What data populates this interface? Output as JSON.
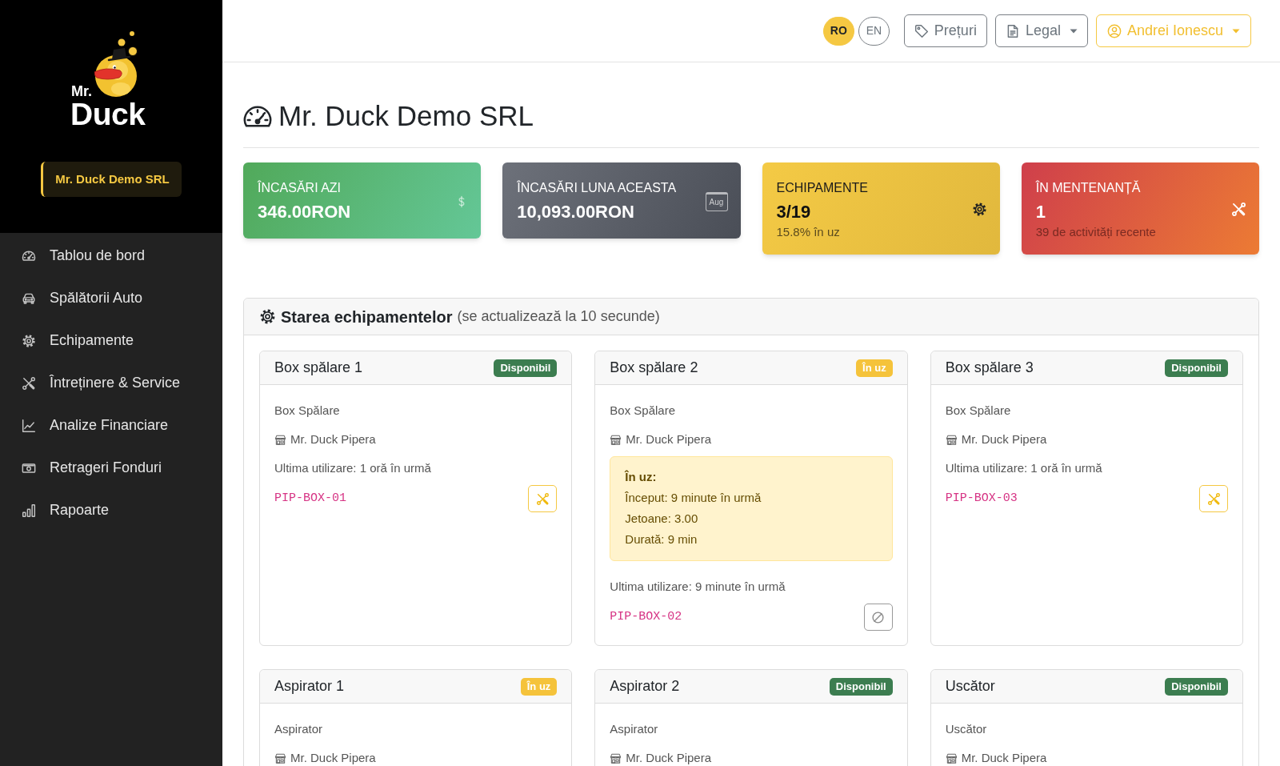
{
  "sidebar": {
    "logo": {
      "small_text": "Mr.",
      "large_text": "Duck"
    },
    "company": "Mr. Duck Demo SRL",
    "items": [
      {
        "label": "Tablou de bord",
        "selected": false
      },
      {
        "label": "Spălătorii Auto",
        "selected": false
      },
      {
        "label": "Echipamente",
        "selected": false
      },
      {
        "label": "Întreținere & Service",
        "selected": false
      },
      {
        "label": "Analize Financiare",
        "selected": false
      },
      {
        "label": "Retrageri Fonduri",
        "selected": false
      },
      {
        "label": "Rapoarte",
        "selected": false
      }
    ]
  },
  "top_bar": {
    "languages": [
      {
        "label": "RO",
        "selected": true
      },
      {
        "label": "EN",
        "selected": false
      }
    ],
    "buttons": [
      {
        "kind": "plain",
        "label": "Prețuri"
      },
      {
        "kind": "dropdown",
        "label": "Legal"
      },
      {
        "kind": "user",
        "label": "Andrei Ionescu"
      }
    ]
  },
  "page": {
    "title": "Mr. Duck Demo SRL"
  },
  "stats": [
    {
      "kind": "success",
      "label": "ÎNCASĂRI AZI",
      "value": "346.00RON"
    },
    {
      "kind": "neutral",
      "label": "ÎNCASĂRI LUNA ACEASTA",
      "value": "10,093.00RON",
      "icon_text": "Aug"
    },
    {
      "kind": "warning",
      "label": "ECHIPAMENTE",
      "value": "3/19",
      "note": "15.8% în uz"
    },
    {
      "kind": "danger",
      "label": "ÎN MENTENANȚĂ",
      "value": "1",
      "note": "39 de activități recente"
    }
  ],
  "equipment_status": {
    "title": "Starea echipamentelor",
    "note": "(se actualizează la 10 secunde)",
    "cards": [
      {
        "name": "Box spălare 1",
        "status": {
          "label": "Disponibil",
          "kind": "available"
        },
        "type": "Box Spălare",
        "location": "Mr. Duck Pipera",
        "last_used": "Ultima utilizare: 1 oră în urmă",
        "code": "PIP-BOX-01",
        "action": {
          "kind": "maintenance"
        }
      },
      {
        "name": "Box spălare 2",
        "status": {
          "label": "În uz",
          "kind": "in_use"
        },
        "type": "Box Spălare",
        "location": "Mr. Duck Pipera",
        "session": {
          "title": "În uz:",
          "lines": [
            "Început: 9 minute în urmă",
            "Jetoane: 3.00",
            "Durată: 9 min"
          ]
        },
        "last_used": "Ultima utilizare: 9 minute în urmă",
        "code": "PIP-BOX-02",
        "action": {
          "kind": "stop"
        }
      },
      {
        "name": "Box spălare 3",
        "status": {
          "label": "Disponibil",
          "kind": "available"
        },
        "type": "Box Spălare",
        "location": "Mr. Duck Pipera",
        "last_used": "Ultima utilizare: 1 oră în urmă",
        "code": "PIP-BOX-03",
        "action": {
          "kind": "maintenance"
        }
      },
      {
        "name": "Aspirator 1",
        "status": {
          "label": "În uz",
          "kind": "in_use"
        },
        "type": "Aspirator",
        "location": "Mr. Duck Pipera"
      },
      {
        "name": "Aspirator 2",
        "status": {
          "label": "Disponibil",
          "kind": "available"
        },
        "type": "Aspirator",
        "location": "Mr. Duck Pipera"
      },
      {
        "name": "Uscător",
        "status": {
          "label": "Disponibil",
          "kind": "available"
        },
        "type": "Uscător",
        "location": "Mr. Duck Pipera"
      }
    ]
  }
}
